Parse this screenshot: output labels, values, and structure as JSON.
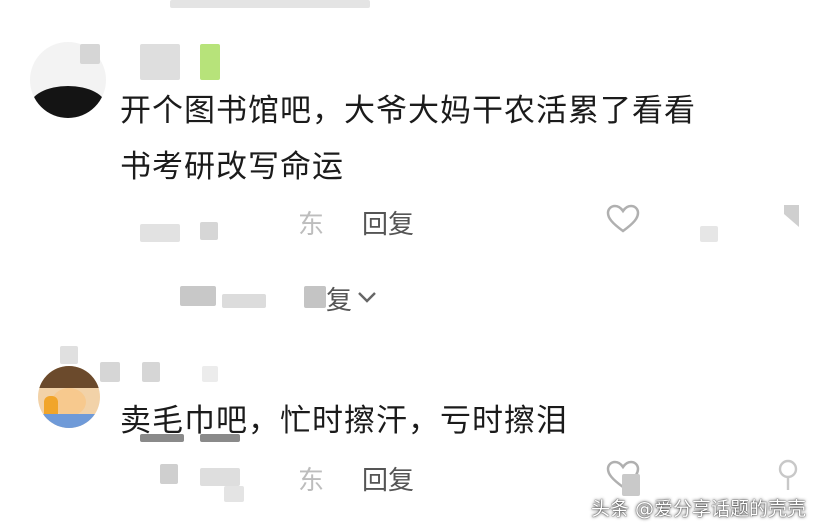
{
  "comments": [
    {
      "text_line1": "开个图书馆吧，大爷大妈干农活累了看看",
      "text_line2": "书考研改写命运",
      "location": "东",
      "reply_label": "回复"
    },
    {
      "text_line1": "卖毛巾吧，忙时擦汗，亏时擦泪",
      "location": "东",
      "reply_label": "回复"
    }
  ],
  "replies_expand": {
    "label_fragment": "复"
  },
  "watermark": "头条 @爱分享话题的壳壳"
}
